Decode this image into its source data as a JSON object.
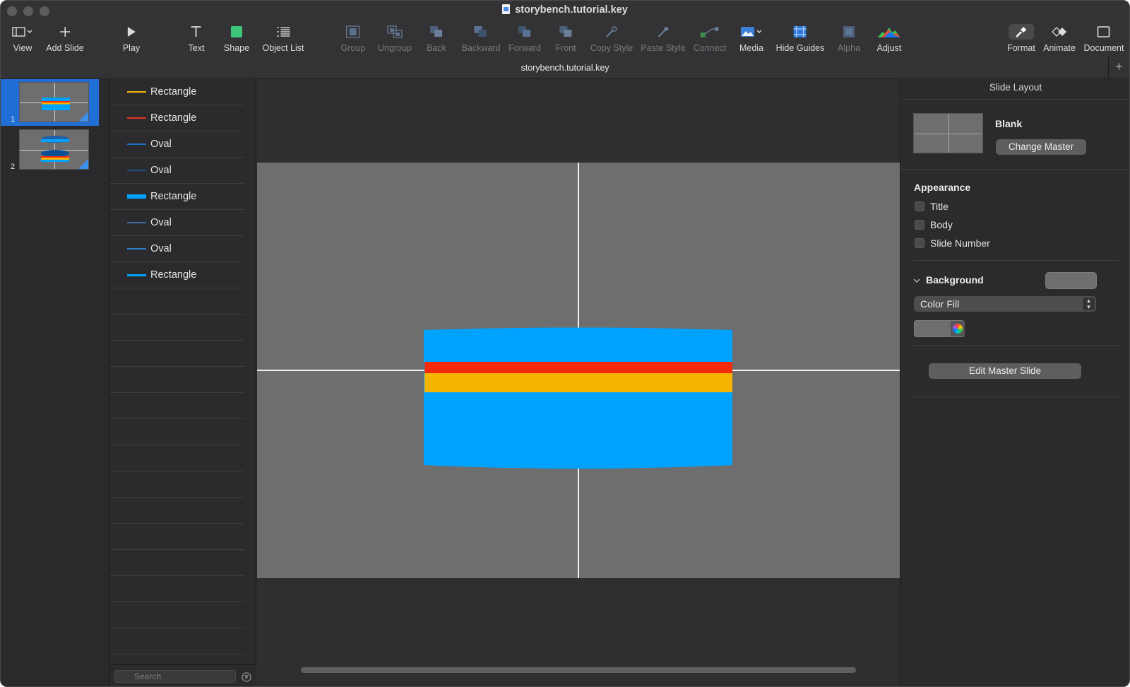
{
  "window": {
    "title": "storybench.tutorial.key",
    "subtitle": "storybench.tutorial.key"
  },
  "toolbar": {
    "items": [
      {
        "label": "View",
        "icon": "view-icon",
        "enabled": true
      },
      {
        "label": "Add Slide",
        "icon": "plus-icon",
        "enabled": true
      },
      {
        "label": "Play",
        "icon": "play-icon",
        "enabled": true
      },
      {
        "label": "Text",
        "icon": "text-icon",
        "enabled": true
      },
      {
        "label": "Shape",
        "icon": "shape-icon",
        "enabled": true
      },
      {
        "label": "Object List",
        "icon": "list-icon",
        "enabled": true
      },
      {
        "label": "Group",
        "icon": "group-icon",
        "enabled": false
      },
      {
        "label": "Ungroup",
        "icon": "ungroup-icon",
        "enabled": false
      },
      {
        "label": "Back",
        "icon": "back-icon",
        "enabled": false
      },
      {
        "label": "Backward",
        "icon": "backward-icon",
        "enabled": false
      },
      {
        "label": "Forward",
        "icon": "forward-icon",
        "enabled": false
      },
      {
        "label": "Front",
        "icon": "front-icon",
        "enabled": false
      },
      {
        "label": "Copy Style",
        "icon": "copy-style-icon",
        "enabled": false
      },
      {
        "label": "Paste Style",
        "icon": "paste-style-icon",
        "enabled": false
      },
      {
        "label": "Connect",
        "icon": "connect-icon",
        "enabled": false
      },
      {
        "label": "Media",
        "icon": "media-icon",
        "enabled": true
      },
      {
        "label": "Hide Guides",
        "icon": "guides-icon",
        "enabled": true
      },
      {
        "label": "Alpha",
        "icon": "alpha-icon",
        "enabled": false
      },
      {
        "label": "Adjust",
        "icon": "adjust-icon",
        "enabled": true
      },
      {
        "label": "Format",
        "icon": "format-brush-icon",
        "enabled": true,
        "active": true
      },
      {
        "label": "Animate",
        "icon": "animate-icon",
        "enabled": true
      },
      {
        "label": "Document",
        "icon": "document-icon",
        "enabled": true
      }
    ]
  },
  "navigator": {
    "slides": [
      {
        "number": "1",
        "selected": true
      },
      {
        "number": "2",
        "selected": false
      }
    ]
  },
  "object_list": {
    "items": [
      {
        "name": "Rectangle",
        "swatch_color": "#f7b500",
        "swatch_weight": "thin"
      },
      {
        "name": "Rectangle",
        "swatch_color": "#e8321e",
        "swatch_weight": "thin"
      },
      {
        "name": "Oval",
        "swatch_color": "#1e6fc8",
        "swatch_weight": "thin"
      },
      {
        "name": "Oval",
        "swatch_color": "#1a4f8c",
        "swatch_weight": "thin"
      },
      {
        "name": "Rectangle",
        "swatch_color": "#00a2ff",
        "swatch_weight": "thick"
      },
      {
        "name": "Oval",
        "swatch_color": "#3b6ea8",
        "swatch_weight": "thin"
      },
      {
        "name": "Oval",
        "swatch_color": "#2f7fd0",
        "swatch_weight": "thin"
      },
      {
        "name": "Rectangle",
        "swatch_color": "#00a2ff",
        "swatch_weight": "medium"
      }
    ],
    "search_placeholder": "Search"
  },
  "canvas": {
    "slide_background": "#6e6e6e",
    "colors": {
      "blue": "#00a2ff",
      "red": "#f52a0a",
      "yellow": "#f7b500"
    }
  },
  "inspector": {
    "title": "Slide Layout",
    "master_name": "Blank",
    "change_master_label": "Change Master",
    "appearance_label": "Appearance",
    "checkboxes": [
      {
        "label": "Title",
        "checked": false
      },
      {
        "label": "Body",
        "checked": false
      },
      {
        "label": "Slide Number",
        "checked": false
      }
    ],
    "background_label": "Background",
    "fill_type": "Color Fill",
    "edit_master_label": "Edit Master Slide"
  }
}
